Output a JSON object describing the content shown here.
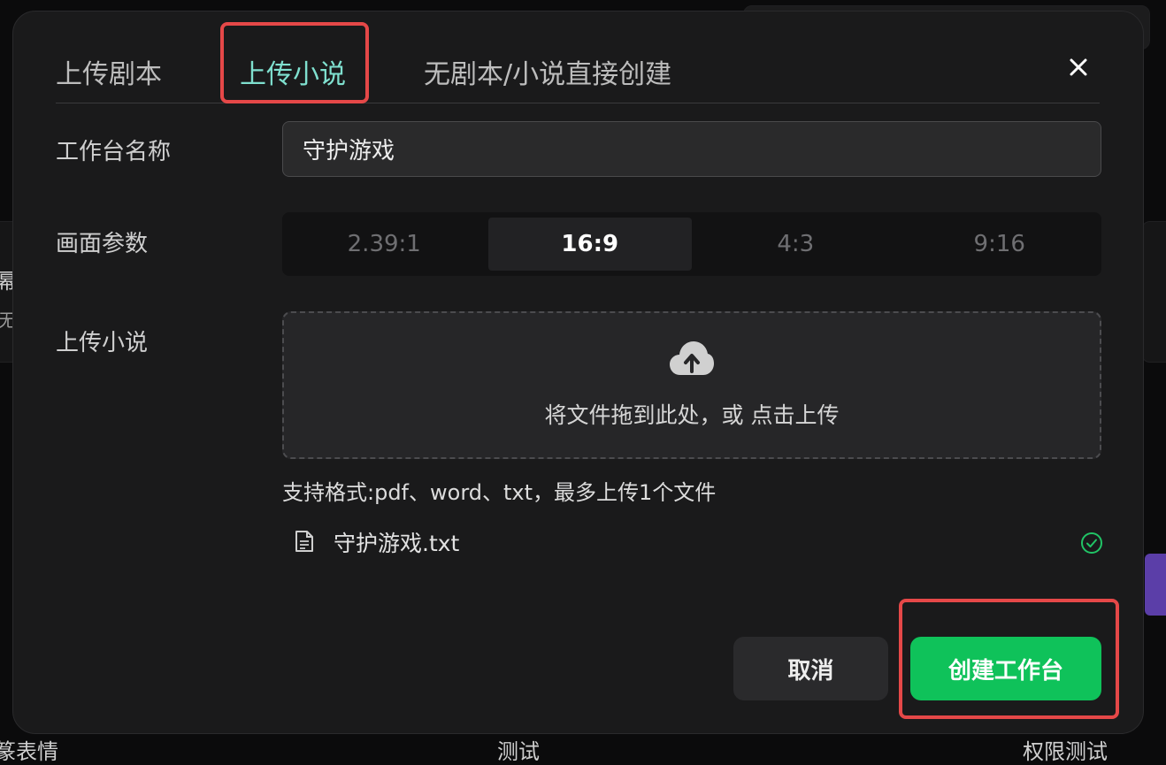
{
  "background": {
    "left_texts": [
      "幂",
      "无",
      "篆表情"
    ],
    "mid_text": "测试",
    "right_text": "权限测试"
  },
  "dialog": {
    "tabs": [
      {
        "label": "上传剧本",
        "active": false
      },
      {
        "label": "上传小说",
        "active": true
      },
      {
        "label": "无剧本/小说直接创建",
        "active": false
      }
    ],
    "close_icon": "close-icon",
    "form": {
      "name_label": "工作台名称",
      "name_value": "守护游戏",
      "ratio_label": "画面参数",
      "ratios": [
        "2.39:1",
        "16:9",
        "4:3",
        "9:16"
      ],
      "selected_ratio": "16:9",
      "upload_label": "上传小说",
      "upload_hint": "将文件拖到此处，或 点击上传",
      "formats_hint": "支持格式:pdf、word、txt，最多上传1个文件",
      "file": {
        "name": "守护游戏.txt",
        "status": "success"
      }
    },
    "actions": {
      "cancel": "取消",
      "create": "创建工作台"
    }
  },
  "colors": {
    "accent_tab": "#7fe0cf",
    "primary_button": "#0fc25a",
    "highlight": "#e54848",
    "success": "#21c466"
  }
}
